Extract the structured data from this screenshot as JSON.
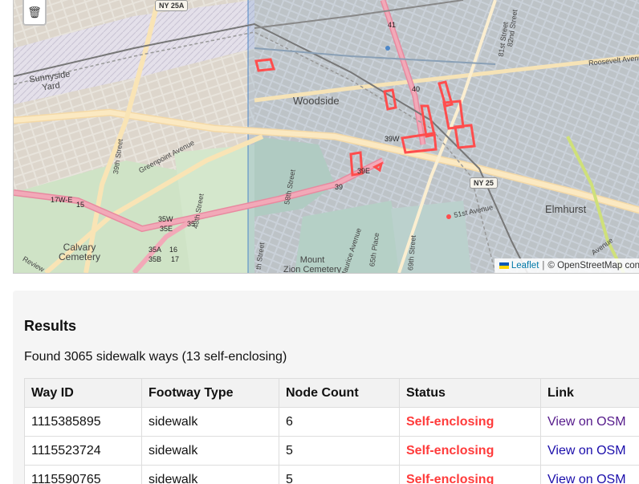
{
  "map": {
    "delete_icon": "trash-icon",
    "places": {
      "woodside": "Woodside",
      "elmhurst": "Elmhurst",
      "sunnyside_yard": "Sunnyside\nYard",
      "calvary_cemetery": "Calvary\nCemetery",
      "mount_zion_cemetery": "Mount\nZion Cemetery"
    },
    "streets": {
      "greenpoint_avenue": "Greenpoint Avenue",
      "street_39th": "39th Street",
      "street_48th": "48th Street",
      "street_58th": "58th Street",
      "street_65th_place": "65th Place",
      "street_69th": "69th Street",
      "maurice_avenue": "Maurice Avenue",
      "street_82nd": "82nd Street",
      "street_81st": "81st Street",
      "roosevelt_avenue": "Roosevelt Avenue",
      "avenue_51st": "51st Avenue",
      "review": "Review",
      "avenue": "Avenue",
      "street_fragment": "th Street"
    },
    "shields": {
      "ny25a": "NY 25A",
      "ny25": "NY 25"
    },
    "exits": [
      "41",
      "40",
      "39W",
      "39E",
      "39",
      "17W-E",
      "15",
      "35W",
      "35E",
      "35",
      "35A",
      "16",
      "35B",
      "17"
    ],
    "attribution": {
      "leaflet": "Leaflet",
      "separator": "|",
      "osm": "© OpenStreetMap con"
    }
  },
  "results": {
    "title": "Results",
    "summary": "Found 3065 sidewalk ways (13 self-enclosing)",
    "columns": [
      "Way ID",
      "Footway Type",
      "Node Count",
      "Status",
      "Link"
    ],
    "rows": [
      {
        "way_id": "1115385895",
        "footway": "sidewalk",
        "nodes": "6",
        "status": "Self-enclosing",
        "link": "View on OSM"
      },
      {
        "way_id": "1115523724",
        "footway": "sidewalk",
        "nodes": "5",
        "status": "Self-enclosing",
        "link": "View on OSM"
      },
      {
        "way_id": "1115590765",
        "footway": "sidewalk",
        "nodes": "5",
        "status": "Self-enclosing",
        "link": "View on OSM"
      }
    ]
  },
  "colors": {
    "status_self_enclosing": "#ff3b3b",
    "highlight_ways": "#ff4d4d",
    "link": "#1a0dab",
    "link_visited": "#551a8b"
  }
}
